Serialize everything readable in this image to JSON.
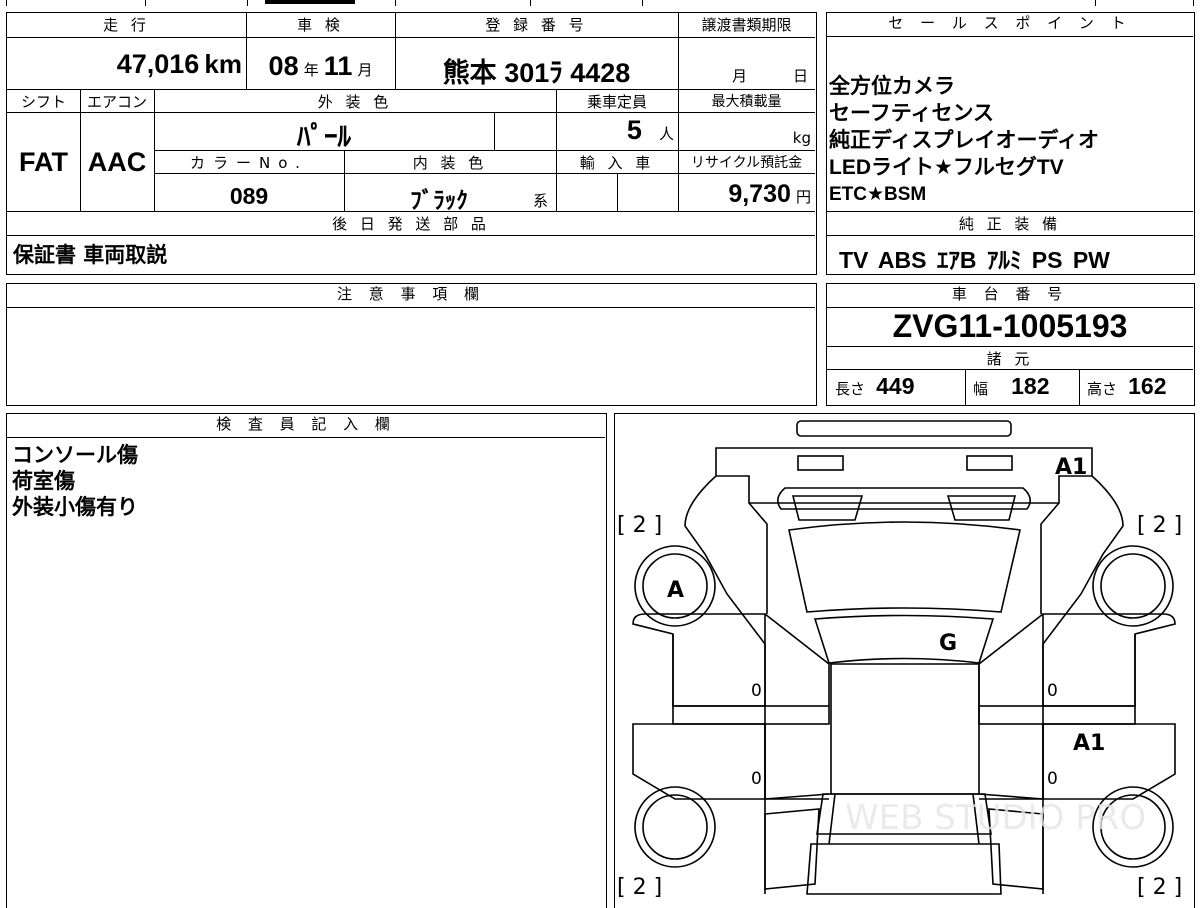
{
  "top_table": {
    "mileage_label": "走 行",
    "mileage_value": "47,016",
    "mileage_unit": "km",
    "inspection_label": "車 検",
    "inspection_year": "08",
    "inspection_year_unit": "年",
    "inspection_month": "11",
    "inspection_month_unit": "月",
    "registration_label": "登 録 番 号",
    "registration_value": "熊本 301ﾗ 4428",
    "transfer_label": "譲渡書類期限",
    "transfer_month_unit": "月",
    "transfer_day_unit": "日",
    "shift_label": "シフト",
    "shift_value": "FAT",
    "aircon_label": "エアコン",
    "aircon_value": "AAC",
    "exterior_color_label": "外 装 色",
    "exterior_color_value": "ﾊﾟｰﾙ",
    "capacity_label": "乗車定員",
    "capacity_value": "5",
    "capacity_unit": "人",
    "max_load_label": "最大積載量",
    "max_load_unit": "kg",
    "color_no_label": "カラーNo.",
    "color_no_value": "089",
    "interior_color_label": "内 装 色",
    "interior_color_value": "ﾌﾞﾗｯｸ",
    "interior_color_suffix": "系",
    "import_label": "輸 入 車",
    "recycle_label": "リサイクル預託金",
    "recycle_value": "9,730",
    "recycle_unit": "円",
    "later_parts_label": "後 日 発 送 部 品",
    "later_parts_value": "保証書 車両取説"
  },
  "sales_points": {
    "label": "セ ー ル ス ポ イ ン ト",
    "lines": [
      "全方位カメラ",
      "セーフティセンス",
      "純正ディスプレイオーディオ",
      "LEDライト★フルセグTV",
      "ETC★BSM"
    ]
  },
  "genuine_equipment": {
    "label": "純 正 装 備",
    "value": "TV ABS ｴｱB ｱﾙﾐ PS PW"
  },
  "caution": {
    "label": "注 意 事 項 欄"
  },
  "chassis": {
    "label": "車 台 番 号",
    "value": "ZVG11-1005193",
    "specs_label": "諸 元",
    "length_label": "長さ",
    "length_value": "449",
    "width_label": "幅",
    "width_value": "182",
    "height_label": "高さ",
    "height_value": "162"
  },
  "inspector": {
    "label": "検 査 員 記 入 欄",
    "lines": [
      "コンソール傷",
      "荷室傷",
      "外装小傷有り"
    ]
  },
  "diagram": {
    "marks": {
      "a1_top": "A1",
      "a1_right": "A1",
      "a_front_left_wheel": "A",
      "g_windshield": "G",
      "zero_left_1": "0",
      "zero_left_2": "0",
      "zero_right_1": "0",
      "zero_right_2": "0",
      "tire_tl": "[ 2 ]",
      "tire_tr": "[ 2 ]",
      "tire_bl": "[ 2 ]",
      "tire_br": "[ 2 ]"
    },
    "watermark": "WEB STUDIO PRO"
  }
}
